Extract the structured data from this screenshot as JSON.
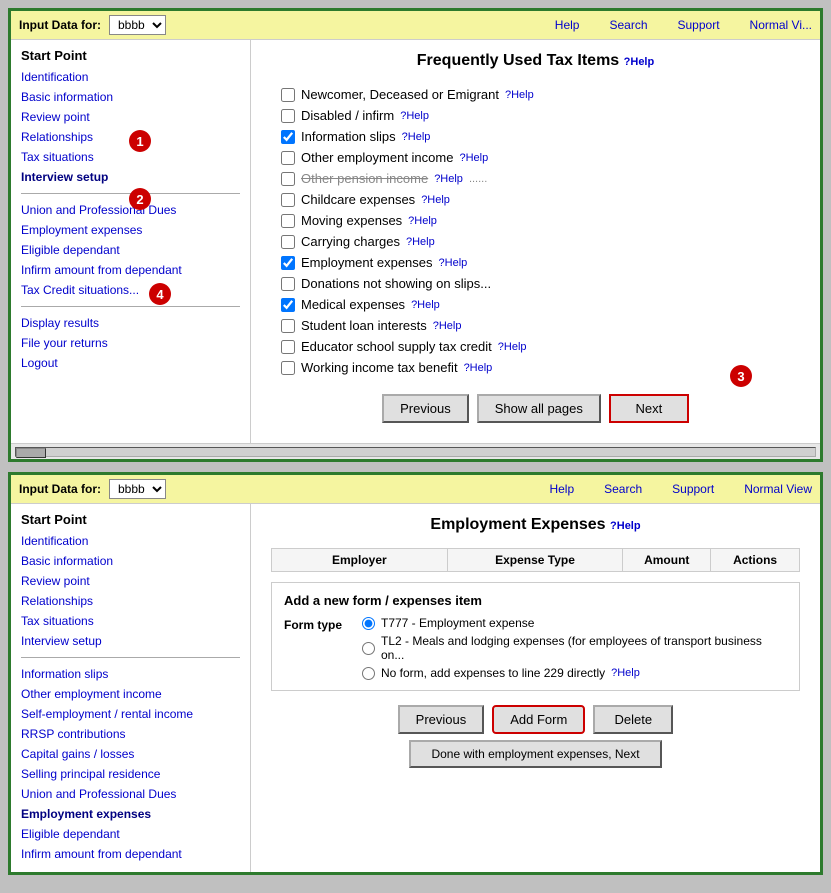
{
  "panel1": {
    "top_bar": {
      "label": "Input Data for:",
      "select_value": "bbbb",
      "select_options": [
        "bbbb"
      ],
      "nav_items": [
        "Help",
        "Search",
        "Support",
        "Normal Vi..."
      ]
    },
    "sidebar": {
      "start_point_label": "Start Point",
      "links": [
        {
          "label": "Identification",
          "active": false
        },
        {
          "label": "Basic information",
          "active": false
        },
        {
          "label": "Review point",
          "active": false
        },
        {
          "label": "Relationships",
          "active": false
        },
        {
          "label": "Tax situations",
          "active": false
        },
        {
          "label": "Interview setup",
          "active": true
        },
        {
          "label": "Union and Professional Dues",
          "active": false
        },
        {
          "label": "Employment expenses",
          "active": false
        },
        {
          "label": "Eligible dependant",
          "active": false
        },
        {
          "label": "Infirm amount from dependant",
          "active": false
        },
        {
          "label": "Tax Credit situations...",
          "active": false
        },
        {
          "label": "Display results",
          "active": false
        },
        {
          "label": "File your returns",
          "active": false
        },
        {
          "label": "Logout",
          "active": false
        }
      ]
    },
    "content": {
      "title": "Frequently Used Tax Items",
      "help_link": "?Help",
      "items": [
        {
          "label": "Newcomer, Deceased or Emigrant",
          "checked": false,
          "help": "?Help"
        },
        {
          "label": "Disabled / infirm",
          "checked": false,
          "help": "?Help"
        },
        {
          "label": "Information slips",
          "checked": true,
          "help": "?Help"
        },
        {
          "label": "Other employment income",
          "checked": false,
          "help": "?Help"
        },
        {
          "label": "Other pension income",
          "checked": false,
          "help": "?Help",
          "strikethrough": true
        },
        {
          "label": "Childcare expenses",
          "checked": false,
          "help": "?Help"
        },
        {
          "label": "Moving expenses",
          "checked": false,
          "help": "?Help"
        },
        {
          "label": "Carrying charges",
          "checked": false,
          "help": "?Help"
        },
        {
          "label": "Employment expenses",
          "checked": true,
          "help": "?Help"
        },
        {
          "label": "Donations not showing on slips...",
          "checked": false,
          "help": ""
        },
        {
          "label": "Medical expenses",
          "checked": true,
          "help": "?Help"
        },
        {
          "label": "Student loan interests",
          "checked": false,
          "help": "?Help"
        },
        {
          "label": "Educator school supply tax credit",
          "checked": false,
          "help": "?Help"
        },
        {
          "label": "Working income tax benefit",
          "checked": false,
          "help": "?Help"
        }
      ],
      "buttons": {
        "previous": "Previous",
        "show_all": "Show all pages",
        "next": "Next"
      }
    }
  },
  "panel2": {
    "top_bar": {
      "label": "Input Data for:",
      "select_value": "bbbb",
      "nav_items": [
        "Help",
        "Search",
        "Support",
        "Normal View"
      ]
    },
    "sidebar": {
      "start_point_label": "Start Point",
      "links": [
        {
          "label": "Identification",
          "active": false
        },
        {
          "label": "Basic information",
          "active": false
        },
        {
          "label": "Review point",
          "active": false
        },
        {
          "label": "Relationships",
          "active": false
        },
        {
          "label": "Tax situations",
          "active": false
        },
        {
          "label": "Interview setup",
          "active": false
        },
        {
          "label": "Information slips",
          "active": false
        },
        {
          "label": "Other employment income",
          "active": false
        },
        {
          "label": "Self-employment / rental income",
          "active": false
        },
        {
          "label": "RRSP contributions",
          "active": false
        },
        {
          "label": "Capital gains / losses",
          "active": false
        },
        {
          "label": "Selling principal residence",
          "active": false
        },
        {
          "label": "Union and Professional Dues",
          "active": false
        },
        {
          "label": "Employment expenses",
          "active": true
        },
        {
          "label": "Eligible dependant",
          "active": false
        },
        {
          "label": "Infirm amount from dependant",
          "active": false
        }
      ]
    },
    "content": {
      "title": "Employment Expenses",
      "help_link": "?Help",
      "table_headers": [
        "Employer",
        "Expense Type",
        "Amount",
        "Actions"
      ],
      "add_section_title": "Add a new form / expenses item",
      "form_type_label": "Form type",
      "form_options": [
        {
          "label": "T777 - Employment expense",
          "selected": true
        },
        {
          "label": "TL2 - Meals and lodging expenses (for employees of transport business on...",
          "selected": false
        },
        {
          "label": "No form, add expenses to line 229 directly",
          "selected": false,
          "help": "?Help"
        }
      ],
      "buttons": {
        "previous": "Previous",
        "add_form": "Add Form",
        "delete": "Delete",
        "done_next": "Done with employment expenses, Next"
      }
    }
  },
  "annotations": {
    "badge1": "1",
    "badge2": "2",
    "badge3": "3",
    "badge4": "4"
  }
}
